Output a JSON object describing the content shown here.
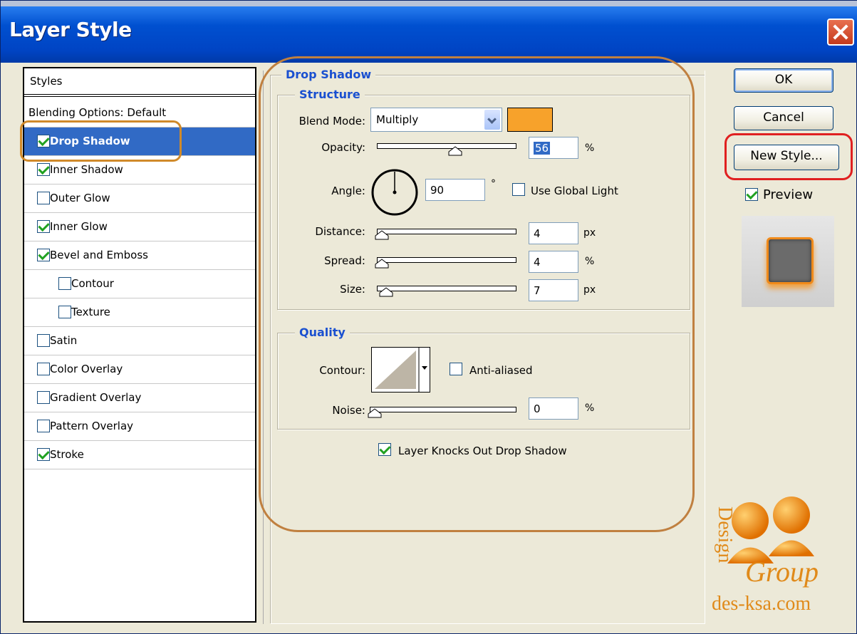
{
  "window": {
    "title": "Layer Style"
  },
  "styles_panel": {
    "header": "Styles",
    "items": [
      {
        "label": "Blending Options: Default",
        "checkbox": false,
        "checked": false,
        "selected": false,
        "indent": 0
      },
      {
        "label": "Drop Shadow",
        "checkbox": true,
        "checked": true,
        "selected": true,
        "indent": 0
      },
      {
        "label": "Inner Shadow",
        "checkbox": true,
        "checked": true,
        "selected": false,
        "indent": 0
      },
      {
        "label": "Outer Glow",
        "checkbox": true,
        "checked": false,
        "selected": false,
        "indent": 0
      },
      {
        "label": "Inner Glow",
        "checkbox": true,
        "checked": true,
        "selected": false,
        "indent": 0
      },
      {
        "label": "Bevel and Emboss",
        "checkbox": true,
        "checked": true,
        "selected": false,
        "indent": 0
      },
      {
        "label": "Contour",
        "checkbox": true,
        "checked": false,
        "selected": false,
        "indent": 1
      },
      {
        "label": "Texture",
        "checkbox": true,
        "checked": false,
        "selected": false,
        "indent": 1
      },
      {
        "label": "Satin",
        "checkbox": true,
        "checked": false,
        "selected": false,
        "indent": 0
      },
      {
        "label": "Color Overlay",
        "checkbox": true,
        "checked": false,
        "selected": false,
        "indent": 0
      },
      {
        "label": "Gradient Overlay",
        "checkbox": true,
        "checked": false,
        "selected": false,
        "indent": 0
      },
      {
        "label": "Pattern Overlay",
        "checkbox": true,
        "checked": false,
        "selected": false,
        "indent": 0
      },
      {
        "label": "Stroke",
        "checkbox": true,
        "checked": true,
        "selected": false,
        "indent": 0
      }
    ]
  },
  "drop_shadow": {
    "title": "Drop Shadow",
    "structure": {
      "title": "Structure",
      "blend_mode": {
        "label": "Blend Mode:",
        "value": "Multiply",
        "color": "#f7a22b"
      },
      "opacity": {
        "label": "Opacity:",
        "value": "56",
        "unit": "%"
      },
      "angle": {
        "label": "Angle:",
        "value": "90",
        "unit": "°",
        "use_global_light": {
          "label": "Use Global Light",
          "checked": false
        }
      },
      "distance": {
        "label": "Distance:",
        "value": "4",
        "unit": "px"
      },
      "spread": {
        "label": "Spread:",
        "value": "4",
        "unit": "%"
      },
      "size": {
        "label": "Size:",
        "value": "7",
        "unit": "px"
      }
    },
    "quality": {
      "title": "Quality",
      "contour": {
        "label": "Contour:",
        "anti_aliased": {
          "label": "Anti-aliased",
          "checked": false
        }
      },
      "noise": {
        "label": "Noise:",
        "value": "0",
        "unit": "%"
      }
    },
    "knockout": {
      "label": "Layer Knocks Out Drop Shadow",
      "checked": true
    }
  },
  "buttons": {
    "ok": "OK",
    "cancel": "Cancel",
    "new_style": "New Style...",
    "preview": {
      "label": "Preview",
      "checked": true
    }
  },
  "watermark": {
    "word": "Design",
    "group": "Group",
    "site": "des-ksa.com"
  },
  "colors": {
    "accent": "#316ac5",
    "legend": "#1a50d0",
    "highlight": "#d08a2a",
    "ring_red": "#e02020"
  }
}
